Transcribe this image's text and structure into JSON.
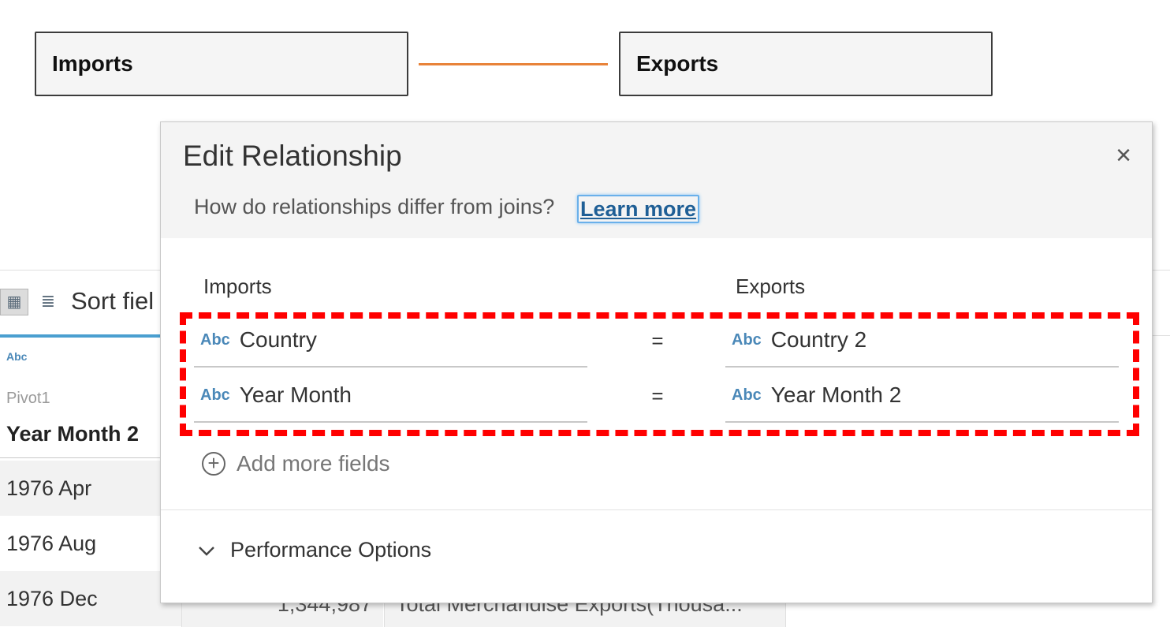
{
  "canvas": {
    "left_table": "Imports",
    "right_table": "Exports"
  },
  "background_grid": {
    "sort_label": "Sort fiel",
    "column_type": "Abc",
    "column_source": "Pivot1",
    "column_name": "Year Month 2",
    "rows": [
      "1976 Apr",
      "1976 Aug",
      "1976 Dec"
    ],
    "row3_value": "1,344,987",
    "row3_description": "Total Merchandise Exports(Thousa..."
  },
  "dialog": {
    "title": "Edit Relationship",
    "close_glyph": "×",
    "help_text": "How do relationships differ from joins?",
    "learn_more": "Learn more",
    "left_header": "Imports",
    "right_header": "Exports",
    "pairs": [
      {
        "left_type": "Abc",
        "left_field": "Country",
        "operator": "=",
        "right_type": "Abc",
        "right_field": "Country 2"
      },
      {
        "left_type": "Abc",
        "left_field": "Year Month",
        "operator": "=",
        "right_type": "Abc",
        "right_field": "Year Month 2"
      }
    ],
    "add_more": "Add more fields",
    "performance": "Performance Options"
  },
  "colors": {
    "relationship_line": "#e8833a",
    "highlight_dash": "#ff0000",
    "link": "#1f5f96",
    "field_type": "#4a88b8"
  }
}
